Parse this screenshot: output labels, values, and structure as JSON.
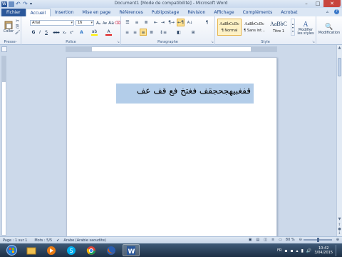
{
  "window": {
    "title": "Document1 [Mode de compatibilité] - Microsoft Word",
    "controls": {
      "minimize": "–",
      "maximize": "□",
      "close": "✕"
    }
  },
  "tabs": {
    "file": "Fichier",
    "items": [
      "Accueil",
      "Insertion",
      "Mise en page",
      "Références",
      "Publipostage",
      "Révision",
      "Affichage",
      "Compléments",
      "Acrobat"
    ],
    "active": "Accueil"
  },
  "ribbon": {
    "clipboard": {
      "paste": "Coller",
      "label": "Presse-pa..."
    },
    "font": {
      "font_name": "Arial",
      "font_size": "16",
      "label": "Police"
    },
    "paragraph": {
      "label": "Paragraphe"
    },
    "styles": {
      "items": [
        {
          "preview": "AaBbCcDc",
          "name": "¶ Normal",
          "selected": true
        },
        {
          "preview": "AaBbCcDc",
          "name": "¶ Sans int...",
          "selected": false
        },
        {
          "preview": "AaBbC",
          "name": "Titre 1",
          "selected": false
        }
      ],
      "change_styles": "Modifier les styles",
      "label": "Style"
    },
    "editing": {
      "label": "Modification"
    }
  },
  "document": {
    "text": "قفغبيهجحجقف  فغتخ فع قف عف",
    "selected": true
  },
  "status": {
    "page": "Page : 1 sur 1",
    "words": "Mots : 5/5",
    "language": "Arabe (Arabie saoudite)",
    "zoom": "80 %"
  },
  "taskbar": {
    "items": [
      "start-orb",
      "explorer",
      "media",
      "skype",
      "chrome",
      "firefox",
      "word"
    ],
    "language": "FR",
    "time": "10:42",
    "date": "3/04/2015"
  },
  "colors": {
    "file_tab": "#2b579a",
    "selection": "#b3cde9",
    "close": "#c8453d"
  }
}
